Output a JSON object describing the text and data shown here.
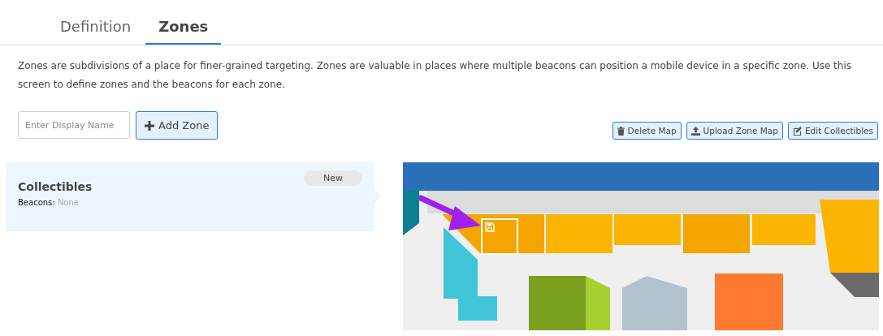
{
  "tabs": [
    {
      "label": "Definition",
      "selected": false
    },
    {
      "label": "Zones",
      "selected": true
    }
  ],
  "description": "Zones are subdivisions of a place for finer-grained targeting. Zones are valuable in places where multiple beacons can position a mobile device in a specific zone. Use this screen to define zones and the beacons for each zone.",
  "zone_name_field": {
    "placeholder": "Enter Display Name"
  },
  "add_button": {
    "label": "Add Zone"
  },
  "map_actions": [
    {
      "kind": "delete",
      "label": "Delete Map"
    },
    {
      "kind": "upload",
      "label": "Upload Zone Map"
    },
    {
      "kind": "edit",
      "label": "Edit Collectibles"
    }
  ],
  "zones": [
    {
      "name": "Collectibles",
      "badge": "New",
      "beacons_label": "Beacons:",
      "beacons_value": "None",
      "selected": true
    }
  ]
}
